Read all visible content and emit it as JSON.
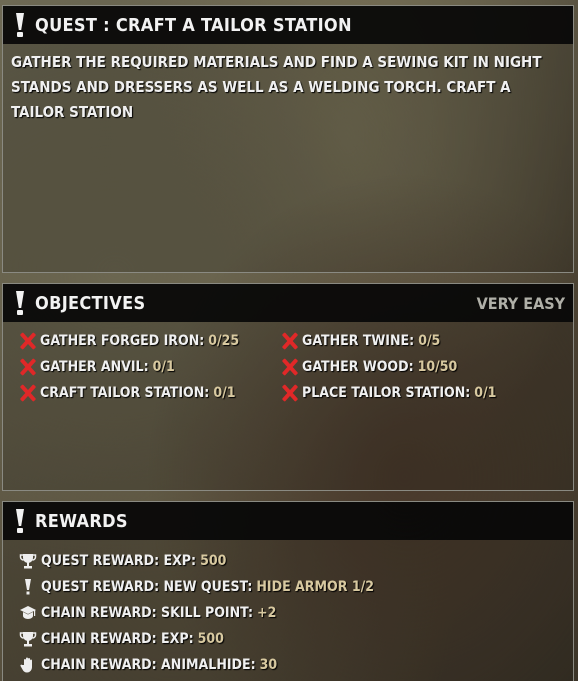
{
  "quest": {
    "title": "QUEST : CRAFT A TAILOR STATION",
    "description": "GATHER THE REQUIRED MATERIALS AND FIND A SEWING KIT IN NIGHT STANDS AND DRESSERS AS WELL AS A WELDING TORCH. CRAFT A TAILOR STATION"
  },
  "objectives": {
    "title": "OBJECTIVES",
    "difficulty": "VERY EASY",
    "items": [
      {
        "label": "GATHER FORGED IRON:",
        "value": "0/25",
        "icon": "red-x-icon"
      },
      {
        "label": "GATHER TWINE:",
        "value": "0/5",
        "icon": "red-x-icon"
      },
      {
        "label": "GATHER ANVIL:",
        "value": "0/1",
        "icon": "red-x-icon"
      },
      {
        "label": "GATHER WOOD:",
        "value": "10/50",
        "icon": "red-x-icon"
      },
      {
        "label": "CRAFT TAILOR STATION:",
        "value": "0/1",
        "icon": "red-x-icon"
      },
      {
        "label": "PLACE TAILOR STATION:",
        "value": "0/1",
        "icon": "red-x-icon"
      }
    ]
  },
  "rewards": {
    "title": "REWARDS",
    "items": [
      {
        "label": "QUEST REWARD: EXP:",
        "value": "500",
        "icon": "trophy-icon"
      },
      {
        "label": "QUEST REWARD: NEW QUEST:",
        "value": "HIDE ARMOR 1/2",
        "icon": "exclamation-icon"
      },
      {
        "label": "CHAIN REWARD: SKILL POINT:",
        "value": "+2",
        "icon": "graduation-cap-icon"
      },
      {
        "label": "CHAIN REWARD: EXP:",
        "value": "500",
        "icon": "trophy-icon"
      },
      {
        "label": "CHAIN REWARD: ANIMALHIDE:",
        "value": "30",
        "icon": "hand-icon"
      }
    ]
  },
  "colors": {
    "value": "#d8c9a0",
    "cross": "#e02828",
    "header_bg": "#080808"
  }
}
